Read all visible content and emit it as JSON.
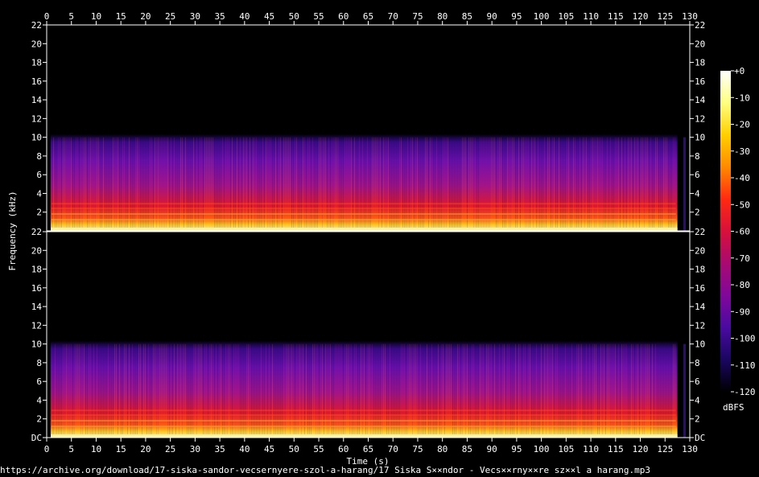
{
  "chart_data": {
    "type": "heatmap",
    "title": "",
    "xlabel": "Time (s)",
    "ylabel": "Frequency (kHz)",
    "x_ticks": [
      "0",
      "5",
      "10",
      "15",
      "20",
      "25",
      "30",
      "35",
      "40",
      "45",
      "50",
      "55",
      "60",
      "65",
      "70",
      "75",
      "80",
      "85",
      "90",
      "95",
      "100",
      "105",
      "110",
      "115",
      "120",
      "125",
      "130"
    ],
    "xlim": [
      0,
      130
    ],
    "ylim": [
      0,
      22
    ],
    "y_ticks_top": [
      "22",
      "20",
      "18",
      "16",
      "14",
      "12",
      "10",
      "8",
      "6",
      "4",
      "2"
    ],
    "y_ticks_bottom": [
      "22",
      "20",
      "18",
      "16",
      "14",
      "12",
      "10",
      "8",
      "6",
      "4",
      "2",
      "DC"
    ],
    "channels": 2,
    "audio_duration_s": 127.5,
    "content_cutoff_khz": 10,
    "colorbar": {
      "label": "dBFS",
      "ticks": [
        "+0",
        "-10",
        "-20",
        "-30",
        "-40",
        "-50",
        "-60",
        "-70",
        "-80",
        "-90",
        "-100",
        "-110",
        "-120"
      ],
      "range": [
        -120,
        0
      ]
    }
  },
  "footer_text": "https://archive.org/download/17-siska-sandor-vecsernyere-szol-a-harang/17 Siska S××ndor - Vecs××rny××re sz××l a harang.mp3"
}
